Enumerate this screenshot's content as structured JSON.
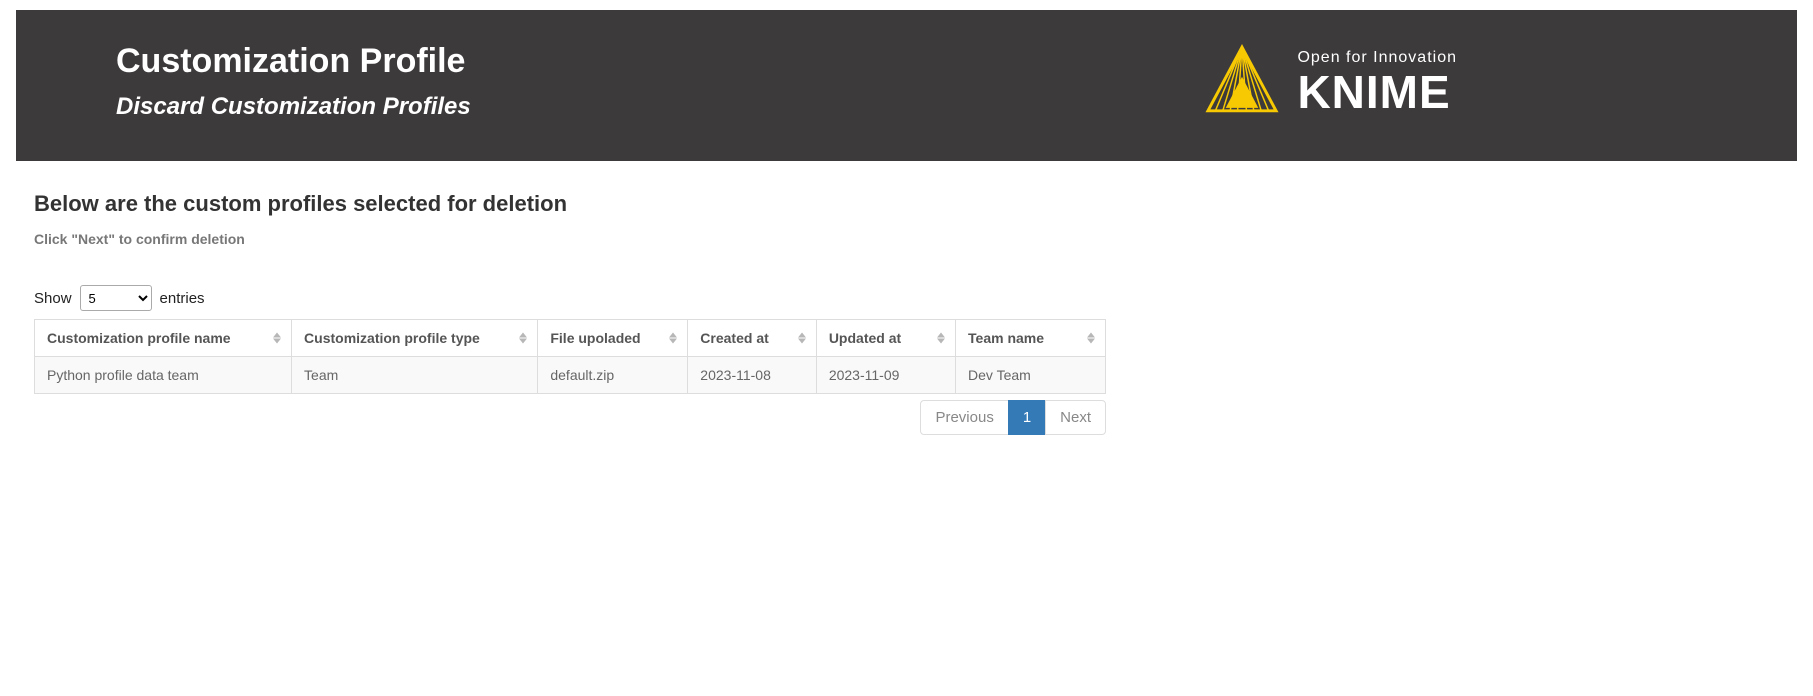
{
  "header": {
    "title": "Customization Profile",
    "subtitle": "Discard Customization Profiles",
    "logo_tagline": "Open for Innovation",
    "logo_name": "KNIME"
  },
  "content": {
    "heading": "Below are the custom profiles selected for deletion",
    "hint": "Click \"Next\" to confirm deletion",
    "show_label": "Show",
    "entries_label": "entries",
    "page_length": "5"
  },
  "table": {
    "columns": [
      "Customization profile name",
      "Customization profile type",
      "File upoladed",
      "Created at",
      "Updated at",
      "Team name"
    ],
    "rows": [
      {
        "name": "Python profile data team",
        "type": "Team",
        "file": "default.zip",
        "created": "2023-11-08",
        "updated": "2023-11-09",
        "team": "Dev Team"
      }
    ]
  },
  "pager": {
    "previous": "Previous",
    "page": "1",
    "next": "Next"
  }
}
